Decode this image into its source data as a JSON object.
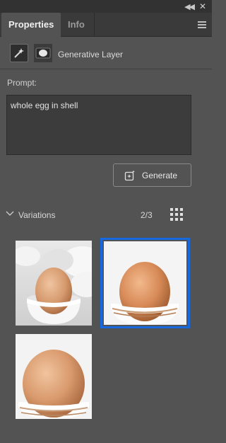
{
  "panel": {
    "tabs": [
      {
        "label": "Properties",
        "active": true
      },
      {
        "label": "Info",
        "active": false
      }
    ]
  },
  "layer": {
    "type_label": "Generative Layer"
  },
  "prompt": {
    "label": "Prompt:",
    "value": "whole egg in shell"
  },
  "generate_button": {
    "label": "Generate"
  },
  "variations": {
    "label": "Variations",
    "count": "2/3",
    "selected_index": 2,
    "thumbnails": [
      {
        "name": "variation-1"
      },
      {
        "name": "variation-2"
      },
      {
        "name": "variation-3"
      }
    ]
  },
  "colors": {
    "panel_bg": "#535353",
    "accent_selection": "#1769e0"
  }
}
